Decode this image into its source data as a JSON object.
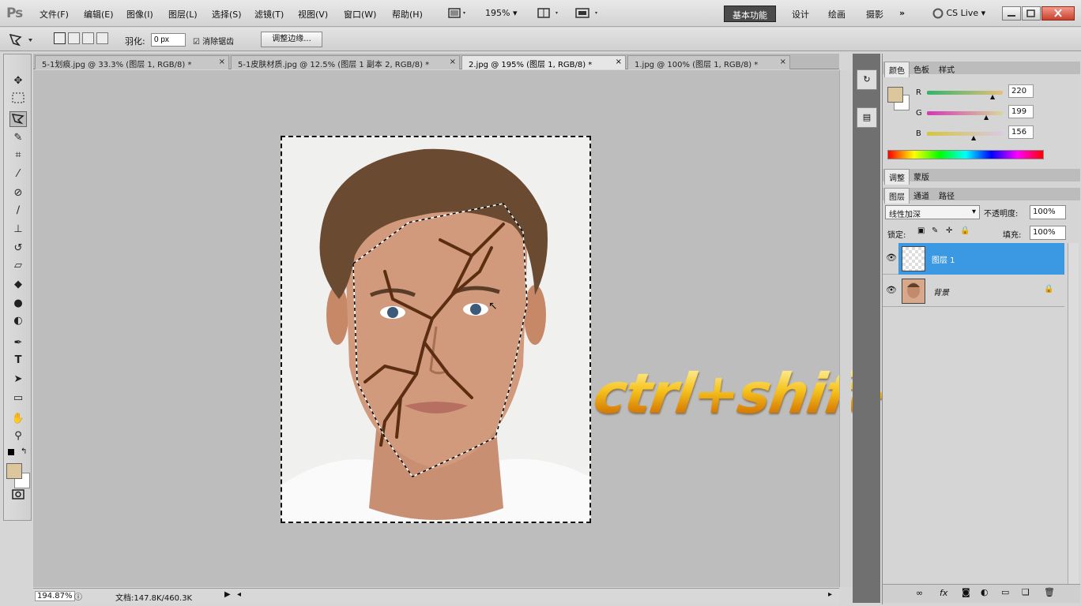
{
  "app": {
    "logo": "Ps"
  },
  "menu": [
    "文件(F)",
    "编辑(E)",
    "图像(I)",
    "图层(L)",
    "选择(S)",
    "滤镜(T)",
    "视图(V)",
    "窗口(W)",
    "帮助(H)"
  ],
  "menubar": {
    "zoom": "195%",
    "workspaces": [
      "基本功能",
      "设计",
      "绘画",
      "摄影"
    ],
    "more": "»",
    "cslive": "CS Live"
  },
  "options": {
    "feather_label": "羽化:",
    "feather_value": "0 px",
    "antialias_label": "消除锯齿",
    "refine_label": "调整边缘..."
  },
  "tabs": [
    {
      "label": "5-1划痕.jpg @ 33.3% (图层 1, RGB/8) *"
    },
    {
      "label": "5-1皮肤材质.jpg @ 12.5% (图层 1 副本 2, RGB/8) *"
    },
    {
      "label": "2.jpg @ 195% (图层 1, RGB/8) *"
    },
    {
      "label": "1.jpg @ 100% (图层 1, RGB/8) *"
    }
  ],
  "status": {
    "zoom": "194.87%",
    "doc": "文档:147.8K/460.3K"
  },
  "color_panel": {
    "tabs": [
      "颜色",
      "色板",
      "样式"
    ],
    "channels": [
      {
        "label": "R",
        "value": "220"
      },
      {
        "label": "G",
        "value": "199"
      },
      {
        "label": "B",
        "value": "156"
      }
    ],
    "fg_color": "#dcc79c"
  },
  "adjust_panel": {
    "tabs": [
      "调整",
      "蒙版"
    ]
  },
  "layers_panel": {
    "tabs": [
      "图层",
      "通道",
      "路径"
    ],
    "blend_mode": "线性加深",
    "opacity_label": "不透明度:",
    "opacity": "100%",
    "lock_label": "锁定:",
    "fill_label": "填充:",
    "fill": "100%",
    "layers": [
      {
        "name": "图层 1",
        "selected": true
      },
      {
        "name": "背景",
        "selected": false
      }
    ]
  },
  "overlay": {
    "shortcut": "ctrl+shift+i"
  }
}
